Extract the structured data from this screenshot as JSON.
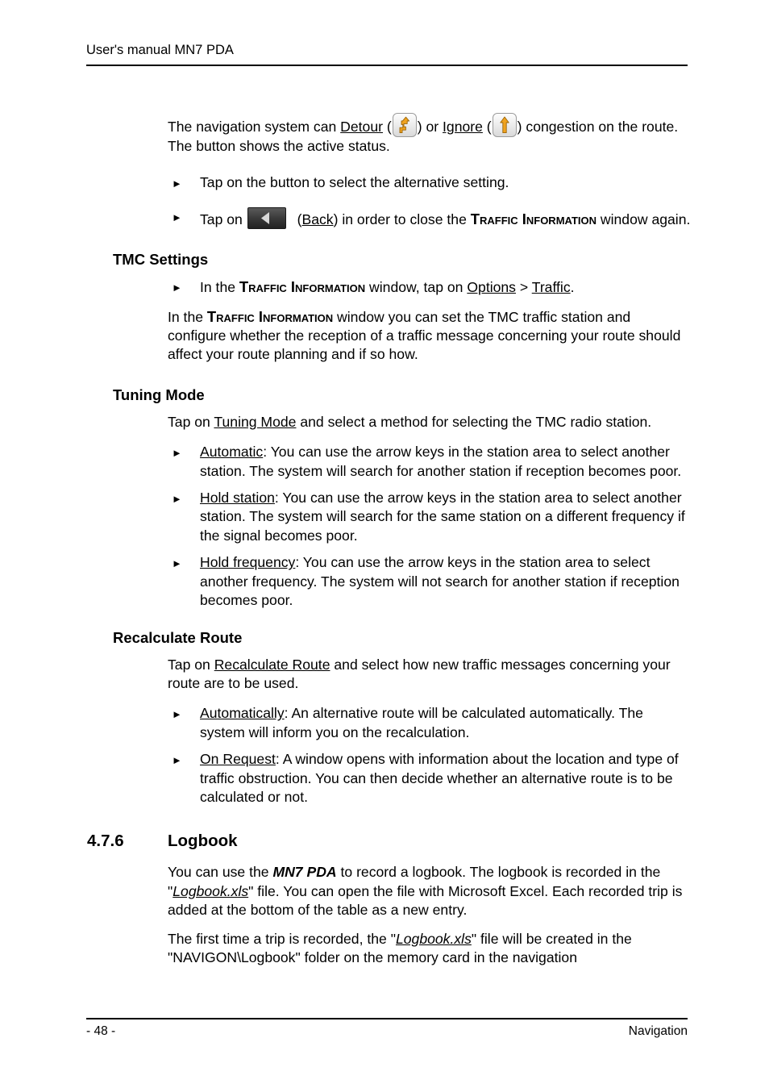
{
  "document": {
    "header": "User's manual MN7 PDA",
    "footer_page": "- 48 -",
    "footer_chapter": "Navigation"
  },
  "icons": {
    "detour": "detour-arrow-icon",
    "ignore": "straight-arrow-icon",
    "back": "back-arrow-icon",
    "bullet": "►",
    "accent_color": "#f0a21e",
    "light_button_color": "#eeeeee",
    "dark_button_color": "#3a3a3a"
  },
  "intro": {
    "p1_a": "The navigation system can ",
    "p1_detour": "Detour",
    "p1_b": " (",
    "p1_c": ") or ",
    "p1_ignore": "Ignore",
    "p1_d": " (",
    "p1_e": ") congestion on the route. The button shows the active status.",
    "b1": "Tap on the button to select the alternative setting.",
    "b2_a": "Tap on ",
    "b2_back": "Back",
    "b2_b": " (",
    "b2_c": ") in order to close the ",
    "b2_window": "Traffic Information",
    "b2_d": " window again."
  },
  "tmc_settings": {
    "heading": "TMC Settings",
    "b1_a": "In the ",
    "b1_window": "Traffic Information",
    "b1_b": " window, tap on ",
    "b1_options": "Options",
    "b1_c": " > ",
    "b1_traffic": "Traffic",
    "b1_d": ".",
    "p1_a": "In the ",
    "p1_window": "Traffic Information",
    "p1_b": " window you can set the TMC traffic station and configure whether the reception of a traffic message concerning your route should affect your route planning and if so how."
  },
  "tuning_mode": {
    "heading": "Tuning Mode",
    "p1_a": "Tap on ",
    "p1_link": "Tuning Mode",
    "p1_b": " and select a method for selecting the TMC radio station.",
    "items": [
      {
        "label": "Automatic",
        "text": ": You can use the arrow keys in the station area to select another station. The system will search for another station if reception becomes poor."
      },
      {
        "label": "Hold station",
        "text": ": You can use the arrow keys in the station area to select another station. The system will search for the same station on a different frequency if the signal becomes poor."
      },
      {
        "label": "Hold frequency",
        "text": ": You can use the arrow keys in the station area to select another frequency. The system will not search for another station if reception becomes poor."
      }
    ]
  },
  "recalculate_route": {
    "heading": "Recalculate Route",
    "p1_a": "Tap on ",
    "p1_link": "Recalculate Route",
    "p1_b": " and select how new traffic messages concerning your route are to be used.",
    "items": [
      {
        "label": "Automatically",
        "text": ": An alternative route will be calculated automatically. The system will inform you on the recalculation."
      },
      {
        "label": "On Request",
        "text": ": A window opens with information about the location and type of traffic obstruction. You can then decide whether an alternative route is to be calculated or not."
      }
    ]
  },
  "logbook": {
    "number": "4.7.6",
    "heading": "Logbook",
    "p1_a": "You can use the ",
    "p1_product": "MN7 PDA",
    "p1_b": " to record a logbook. The logbook is recorded in the \"",
    "p1_file": "Logbook.xls",
    "p1_c": "\" file. You can open the file with Microsoft Excel. Each recorded trip is added at the bottom of the table as a new entry.",
    "p2_a": "The first time a trip is recorded, the \"",
    "p2_file": "Logbook.xls",
    "p2_b": "\" file will be created in the \"NAVIGON\\Logbook\" folder on the memory card in the navigation"
  }
}
